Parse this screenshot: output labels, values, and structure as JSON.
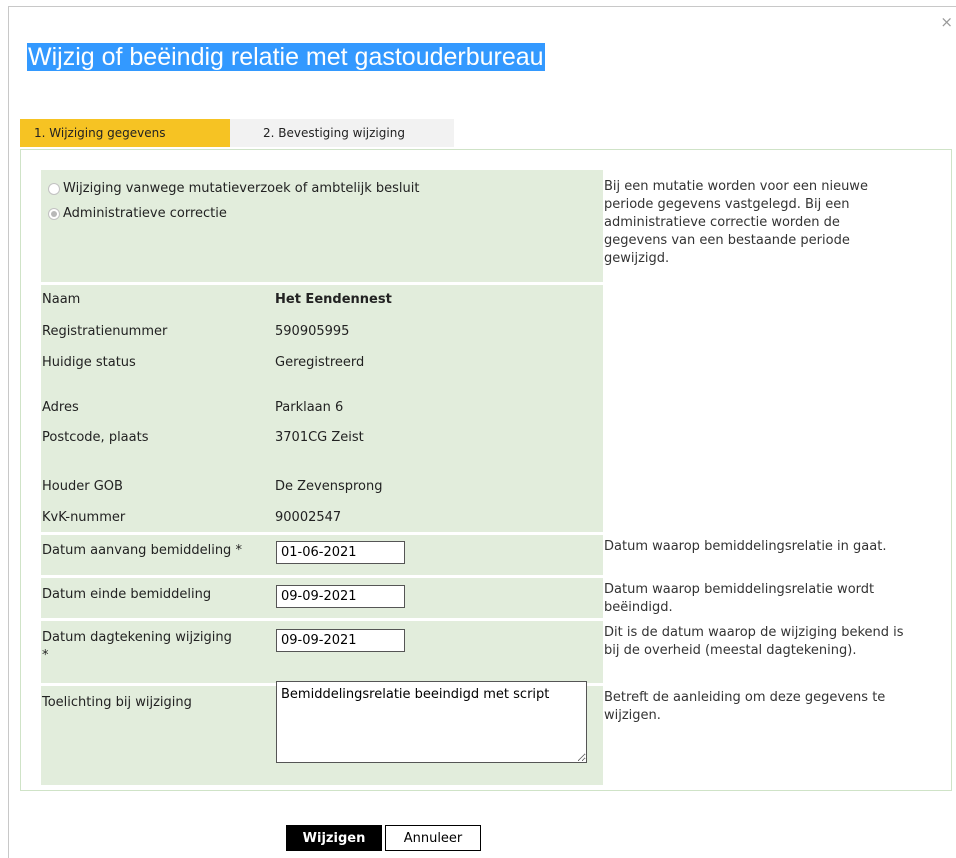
{
  "dialog": {
    "close": "×",
    "title": "Wijzig of beëindig relatie met gastouderbureau"
  },
  "steps": [
    {
      "label": "1. Wijziging gegevens",
      "active": true
    },
    {
      "label": "2. Bevestiging wijziging",
      "active": false
    }
  ],
  "mutation_type": {
    "options": [
      {
        "label": "Wijziging vanwege mutatieverzoek of ambtelijk besluit",
        "selected": false
      },
      {
        "label": "Administratieve correctie",
        "selected": true
      }
    ],
    "help": "Bij een mutatie worden voor een nieuwe periode gegevens vastgelegd. Bij een administratieve correctie worden de gegevens van een bestaande periode gewijzigd."
  },
  "details": {
    "name": {
      "label": "Naam",
      "value": "Het Eendennest"
    },
    "registration": {
      "label": "Registratienummer",
      "value": "590905995"
    },
    "status": {
      "label": "Huidige status",
      "value": "Geregistreerd"
    },
    "address": {
      "label": "Adres",
      "value": "Parklaan 6"
    },
    "postcode": {
      "label": "Postcode, plaats",
      "value": "3701CG Zeist"
    },
    "holder": {
      "label": "Houder GOB",
      "value": "De Zevensprong"
    },
    "kvk": {
      "label": "KvK-nummer",
      "value": "90002547"
    }
  },
  "form": {
    "start_date": {
      "label": "Datum aanvang bemiddeling *",
      "value": "01-06-2021",
      "help": "Datum waarop bemiddelingsrelatie in gaat."
    },
    "end_date": {
      "label": "Datum einde bemiddeling",
      "value": "09-09-2021",
      "help": "Datum waarop bemiddelingsrelatie wordt beëindigd."
    },
    "change_date": {
      "label_line1": "Datum dagtekening wijziging",
      "label_line2": "*",
      "value": "09-09-2021",
      "help": "Dit is de datum waarop de wijziging bekend is bij de overheid (meestal dagtekening)."
    },
    "explanation": {
      "label": "Toelichting bij wijziging",
      "value": "Bemiddelingsrelatie beeindigd met script",
      "help": "Betreft de aanleiding om deze gegevens te wijzigen."
    }
  },
  "buttons": {
    "submit": "Wijzigen",
    "cancel": "Annuleer"
  },
  "colors": {
    "step_active": "#f6c323",
    "step_inactive": "#f2f2f2",
    "section_bg": "#e2eddc",
    "title_highlight": "#3399ff"
  }
}
